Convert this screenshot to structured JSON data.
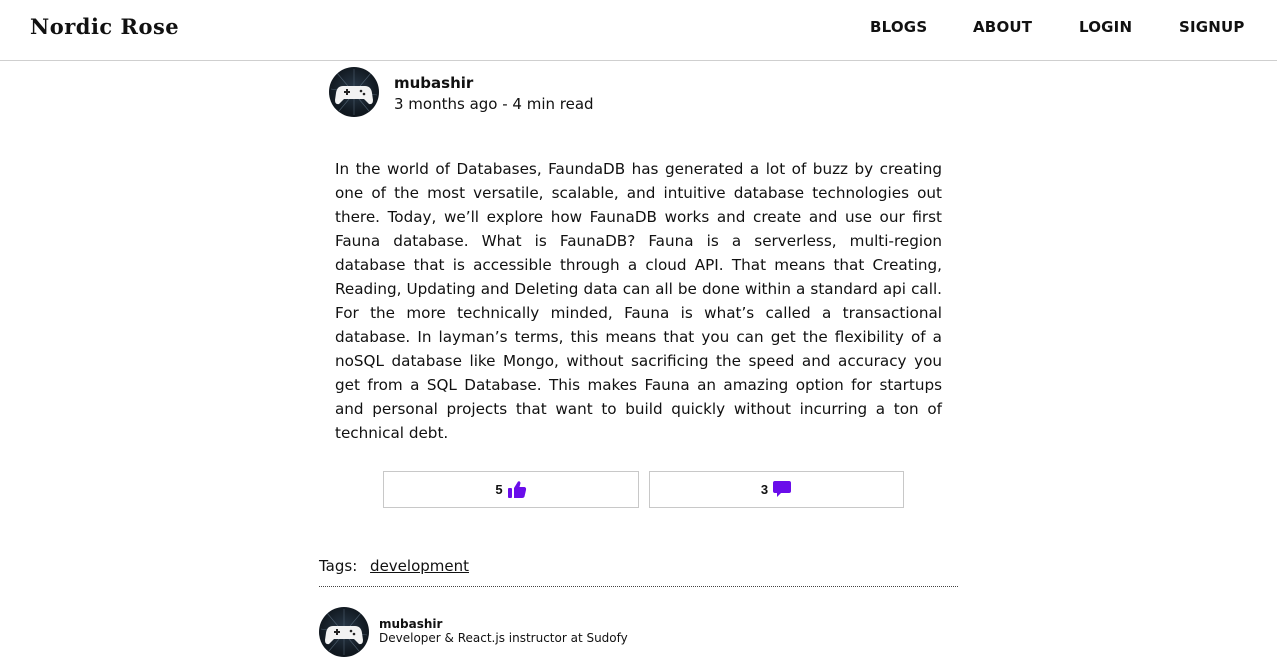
{
  "brand": "Nordic Rose",
  "nav": {
    "blogs": "BLOGS",
    "about": "ABOUT",
    "login": "LOGIN",
    "signup": "SIGNUP"
  },
  "post": {
    "author": "mubashir",
    "meta": "3 months ago - 4 min read",
    "body": "In the world of Databases, FaundaDB has generated a lot of buzz by creating one of the most versatile, scalable, and intuitive database technologies out there. Today, we’ll explore how FaunaDB works and create and use our first Fauna database. What is FaunaDB? Fauna is a serverless, multi-region database that is accessible through a cloud API. That means that Creating, Reading, Updating and Deleting data can all be done within a standard api call. For the more technically minded, Fauna is what’s called a transactional database. In layman’s terms, this means that you can get the flexibility of a noSQL database like Mongo, without sacrificing the speed and accuracy you get from a SQL Database. This makes Fauna an amazing option for startups and personal projects that want to build quickly without incurring a ton of technical debt.",
    "likes": "5",
    "comments": "3",
    "like_icon": "thumbs-up-icon",
    "comment_icon": "comment-icon",
    "icon_color": "#6a0dea"
  },
  "tags": {
    "label": "Tags:",
    "items": [
      "development"
    ]
  },
  "footer_author": {
    "name": "mubashir",
    "bio": "Developer & React.js instructor at Sudofy"
  }
}
